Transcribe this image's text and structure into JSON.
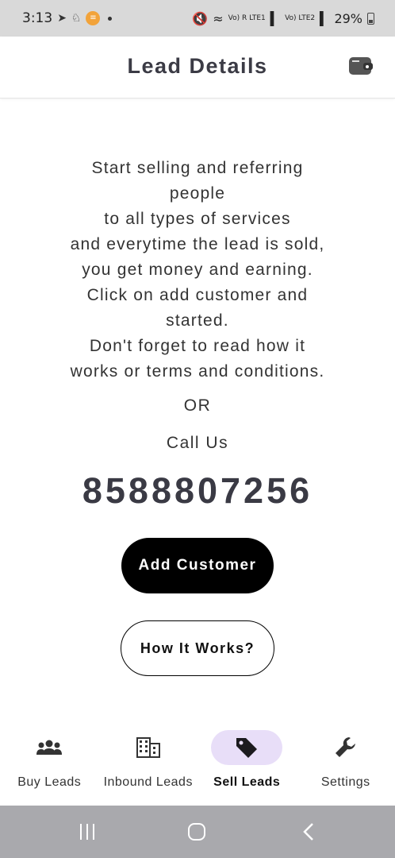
{
  "status_bar": {
    "time": "3:13",
    "battery": "29%",
    "signal_text_1": "Vo) R LTE1",
    "signal_text_2": "Vo) LTE2"
  },
  "header": {
    "title": "Lead Details"
  },
  "intro": {
    "lines": [
      "Start selling and referring",
      "people",
      "to all types of services",
      "and everytime the lead is sold,",
      "you get money and earning.",
      "Click on add customer and",
      "started.",
      "Don't forget to read how it",
      "works or terms and conditions."
    ]
  },
  "or_text": "OR",
  "call_text": "Call Us",
  "phone": "8588807256",
  "buttons": {
    "add_customer": "Add Customer",
    "how_it_works": "How It Works?"
  },
  "nav": {
    "items": [
      {
        "label": "Buy Leads",
        "icon": "group-icon",
        "active": false
      },
      {
        "label": "Inbound Leads",
        "icon": "building-icon",
        "active": false
      },
      {
        "label": "Sell Leads",
        "icon": "tag-icon",
        "active": true
      },
      {
        "label": "Settings",
        "icon": "wrench-icon",
        "active": false
      }
    ]
  },
  "colors": {
    "active_pill": "#e8def8",
    "primary_button": "#000000",
    "title_text": "#3b3b45"
  }
}
